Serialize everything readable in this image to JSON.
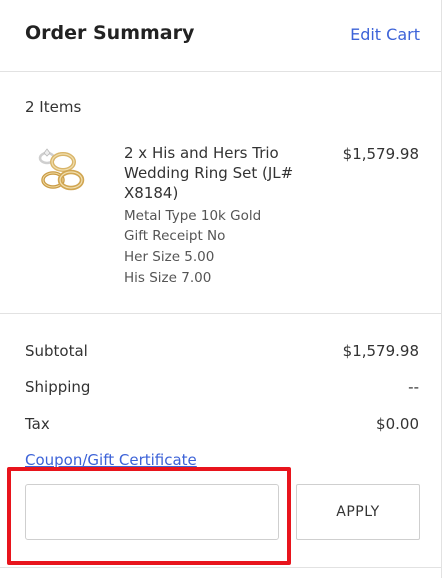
{
  "header": {
    "title": "Order Summary",
    "edit_cart_label": "Edit Cart"
  },
  "items_count": "2 Items",
  "product": {
    "thumbnail_icon": "ring-set-thumbnail-icon",
    "name": "2 x His and Hers Trio Wedding Ring Set (JL# X8184)",
    "price": "$1,579.98",
    "attributes": [
      "Metal Type 10k Gold",
      "Gift Receipt No",
      "Her Size 5.00",
      "His Size 7.00"
    ]
  },
  "summary": {
    "subtotal_label": "Subtotal",
    "subtotal_value": "$1,579.98",
    "shipping_label": "Shipping",
    "shipping_value": "--",
    "tax_label": "Tax",
    "tax_value": "$0.00"
  },
  "coupon": {
    "link_label": "Coupon/Gift Certificate",
    "input_value": "",
    "input_placeholder": "",
    "apply_label": "APPLY"
  },
  "colors": {
    "link": "#3d63d8",
    "highlight": "#e8141c",
    "border": "#e2e2e2"
  }
}
